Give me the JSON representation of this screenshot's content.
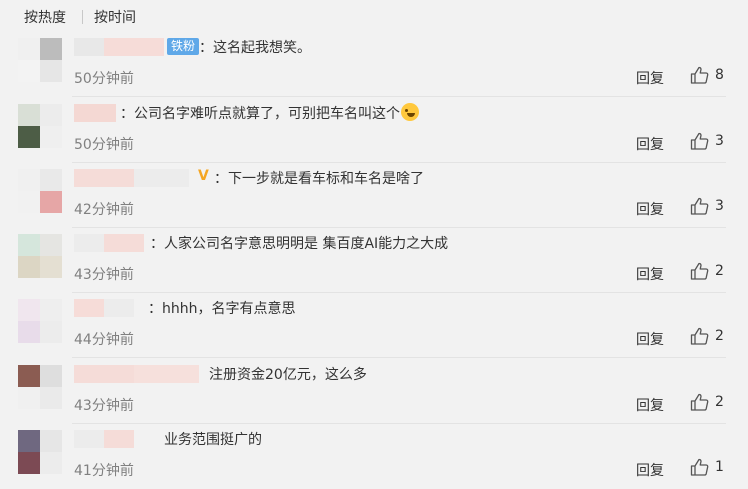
{
  "sort_tabs": {
    "hot": "按热度",
    "time": "按时间"
  },
  "reply_label": "回复",
  "fan_badge": "铁粉",
  "vip_mark": "V",
  "comments": [
    {
      "text": "：这名起我想笑。",
      "time": "50分钟前",
      "likes": "8"
    },
    {
      "text": "：公司名字难听点就算了，可别把车名叫这个",
      "time": "50分钟前",
      "likes": "3"
    },
    {
      "text": "：下一步就是看车标和车名是啥了",
      "time": "42分钟前",
      "likes": "3"
    },
    {
      "text": "：人家公司名字意思明明是   集百度AI能力之大成",
      "time": "43分钟前",
      "likes": "2"
    },
    {
      "text": "：hhhh，名字有点意思",
      "time": "44分钟前",
      "likes": "2"
    },
    {
      "text": "注册资金20亿元，这么多",
      "time": "43分钟前",
      "likes": "2"
    },
    {
      "text": "业务范围挺广的",
      "time": "41分钟前",
      "likes": "1"
    }
  ],
  "icons": {
    "like": "thumbs-up-icon",
    "emoji": "laughing-emoji-icon"
  }
}
